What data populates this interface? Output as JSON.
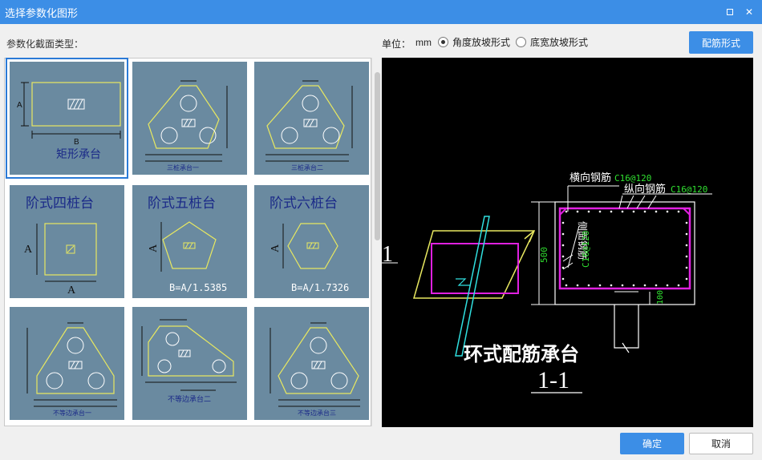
{
  "window": {
    "title": "选择参数化图形",
    "maximize_icon": "maximize-icon",
    "close_icon": "close-icon"
  },
  "toolbar": {
    "section_label": "参数化截面类型：",
    "unit_label": "单位：",
    "unit_value": "mm",
    "radio_options": [
      {
        "label": "角度放坡形式",
        "checked": true
      },
      {
        "label": "底宽放坡形式",
        "checked": false
      }
    ],
    "rebar_button": "配筋形式"
  },
  "shapes": [
    {
      "id": "rect",
      "caption": "矩形承台",
      "dim_a": "A",
      "dim_b": "B",
      "selected": true
    },
    {
      "id": "tri1",
      "caption": "三桩承台一",
      "selected": false
    },
    {
      "id": "tri2",
      "caption": "三桩承台二",
      "selected": false
    },
    {
      "id": "step4",
      "caption": "阶式四桩台",
      "dim_a": "A",
      "dim_b": "A",
      "selected": false
    },
    {
      "id": "step5",
      "caption": "阶式五桩台",
      "dim_a": "A",
      "formula": "B=A/1.5385",
      "selected": false
    },
    {
      "id": "step6",
      "caption": "阶式六桩台",
      "dim_a": "A",
      "formula": "B=A/1.7326",
      "selected": false
    },
    {
      "id": "uneq1",
      "caption": "不等边承台一",
      "selected": false
    },
    {
      "id": "uneq2",
      "caption": "不等边承台二",
      "selected": false
    },
    {
      "id": "uneq3",
      "caption": "不等边承台三",
      "selected": false
    }
  ],
  "preview": {
    "title": "环式配筋承台",
    "section": "1-1",
    "side_label": "1",
    "transverse_label": "横向钢筋",
    "transverse_spec": "C16@120",
    "longitudinal_label": "纵向钢筋",
    "longitudinal_spec": "C16@120",
    "side_rebar_label": "侧面钢筋",
    "side_rebar_spec": "C16@120",
    "dim_500": "500",
    "dim_100": "100"
  },
  "footer": {
    "ok": "确定",
    "cancel": "取消"
  },
  "colors": {
    "titlebar": "#3c8ee6",
    "cell_bg": "#6a8aa0",
    "shape_yellow": "#e8e860",
    "preview_bg": "#000000",
    "rebar_magenta": "#e020e0",
    "dim_green": "#30e030",
    "pile_cyan": "#30e0e0"
  },
  "icons": {
    "hatch": "hatch-icon"
  }
}
